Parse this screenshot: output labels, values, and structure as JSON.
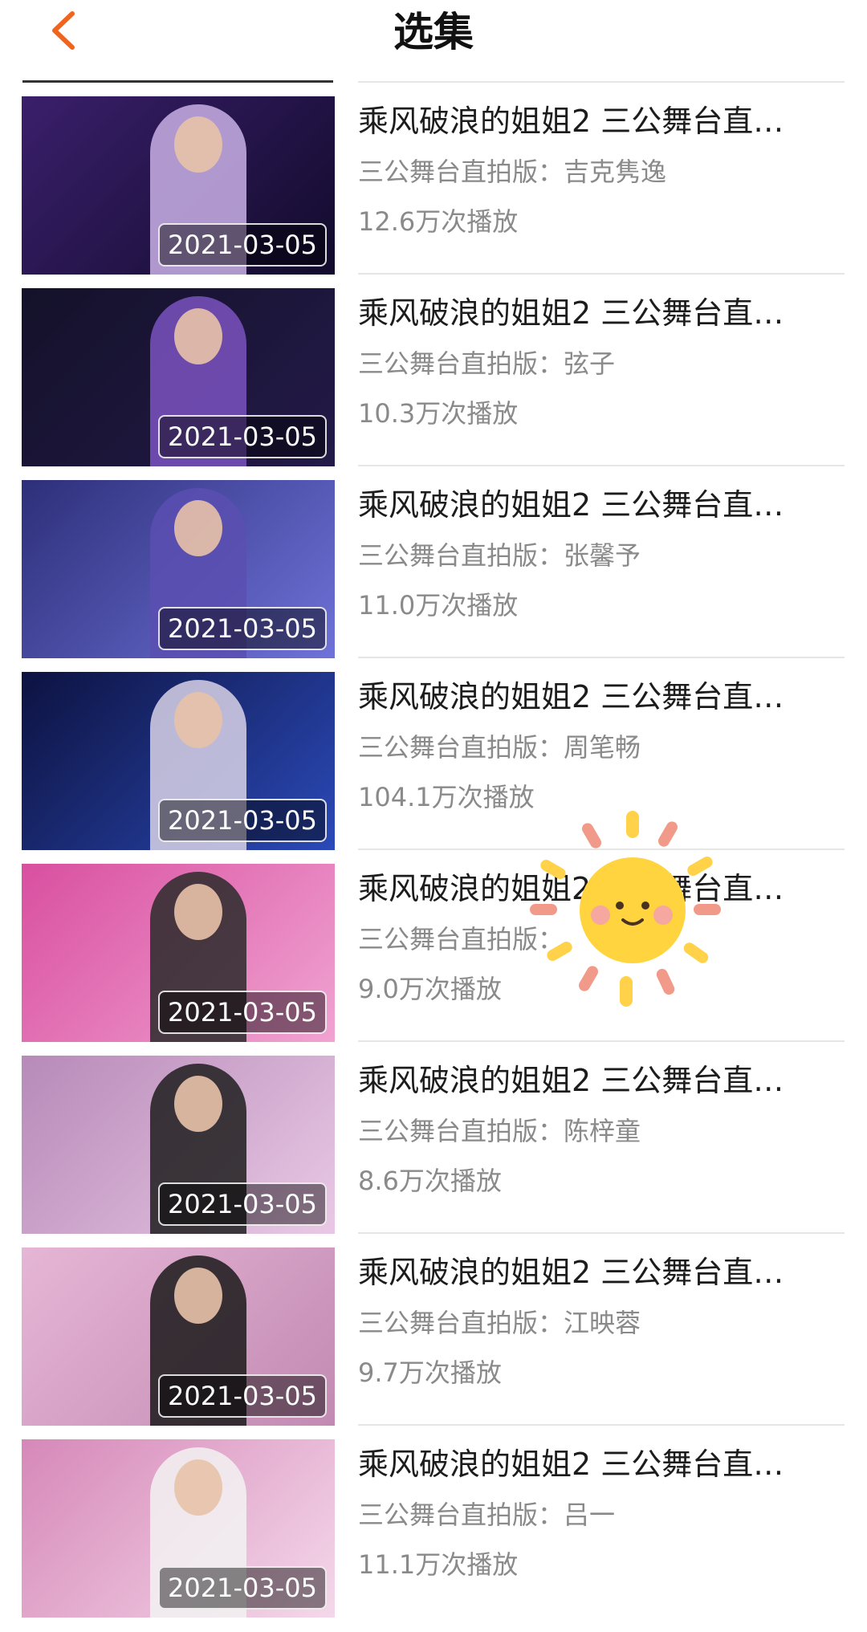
{
  "header": {
    "title": "选集",
    "back_icon": "chevron-left-icon",
    "accent": "#f0641e"
  },
  "episodes": [
    {
      "title": "乘风破浪的姐姐2 三公舞台直…",
      "subtitle": "三公舞台直拍版：吉克隽逸",
      "views": "12.6万次播放",
      "date": "2021-03-05",
      "bg": "#3a1f6b",
      "bg2": "#120b2c",
      "figure": "#c9b0e6"
    },
    {
      "title": "乘风破浪的姐姐2 三公舞台直…",
      "subtitle": "三公舞台直拍版：弦子",
      "views": "10.3万次播放",
      "date": "2021-03-05",
      "bg": "#14112a",
      "bg2": "#231a48",
      "figure": "#7a52c0"
    },
    {
      "title": "乘风破浪的姐姐2 三公舞台直…",
      "subtitle": "三公舞台直拍版：张馨予",
      "views": "11.0万次播放",
      "date": "2021-03-05",
      "bg": "#2d2f7a",
      "bg2": "#6f72d8",
      "figure": "#5a4fb2"
    },
    {
      "title": "乘风破浪的姐姐2 三公舞台直…",
      "subtitle": "三公舞台直拍版：周笔畅",
      "views": "104.1万次播放",
      "date": "2021-03-05",
      "bg": "#0d1240",
      "bg2": "#2b4ab8",
      "figure": "#d8d2e8"
    },
    {
      "title": "乘风破浪的姐姐2 三公舞台直…",
      "subtitle": "三公舞台直拍版：",
      "views": "9.0万次播放",
      "date": "2021-03-05",
      "bg": "#d94fa0",
      "bg2": "#f0a3d2",
      "figure": "#2a2a2a"
    },
    {
      "title": "乘风破浪的姐姐2 三公舞台直…",
      "subtitle": "三公舞台直拍版：陈梓童",
      "views": "8.6万次播放",
      "date": "2021-03-05",
      "bg": "#b78ab8",
      "bg2": "#e9c8e5",
      "figure": "#1e1e1e"
    },
    {
      "title": "乘风破浪的姐姐2 三公舞台直…",
      "subtitle": "三公舞台直拍版：江映蓉",
      "views": "9.7万次播放",
      "date": "2021-03-05",
      "bg": "#e6b6d6",
      "bg2": "#c28ab2",
      "figure": "#1a1a1a"
    },
    {
      "title": "乘风破浪的姐姐2 三公舞台直…",
      "subtitle": "三公舞台直拍版：吕一",
      "views": "11.1万次播放",
      "date": "2021-03-05",
      "bg": "#d688b8",
      "bg2": "#f4d8ea",
      "figure": "#f2f2f2"
    }
  ],
  "sticker": {
    "icon": "sun-sticker-icon"
  }
}
